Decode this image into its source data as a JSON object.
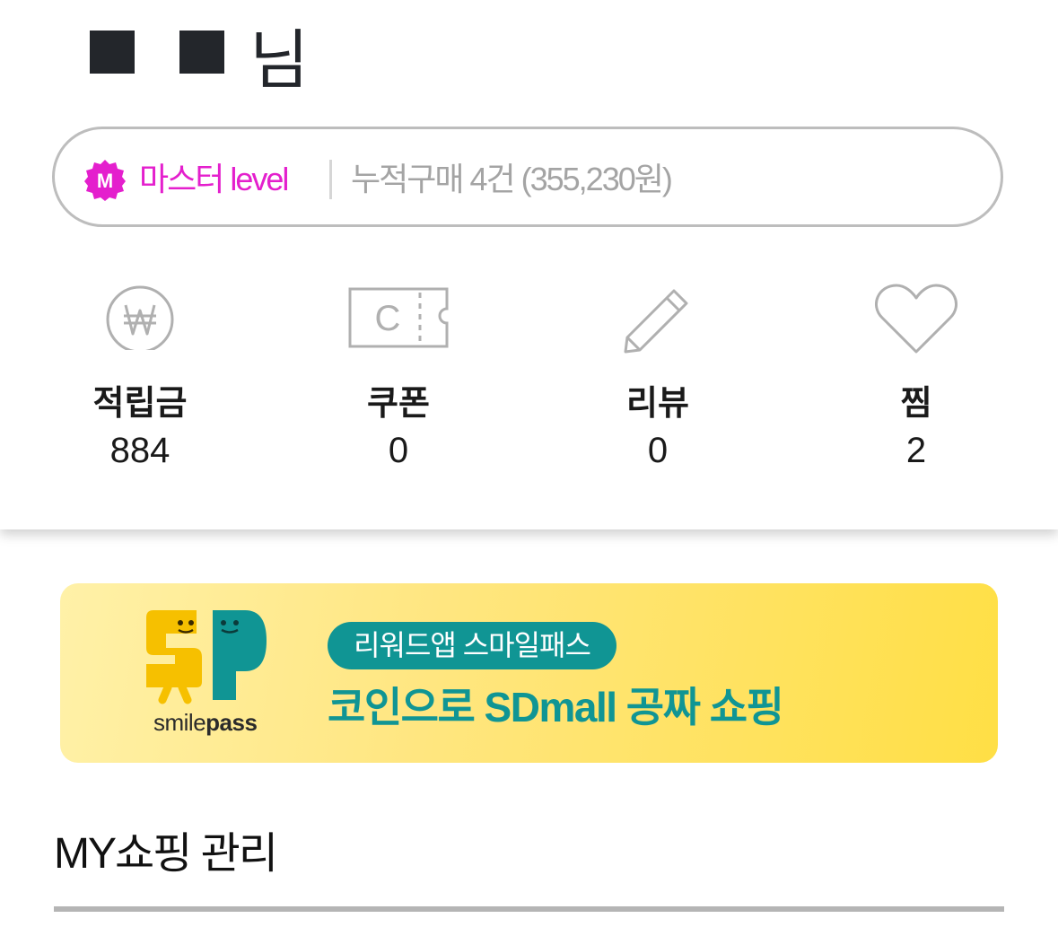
{
  "profile": {
    "name_suffix": "님",
    "level": {
      "badge_letter": "M",
      "name": "마스터 level",
      "summary": "누적구매 4건 (355,230원)",
      "color": "#e41fcd"
    },
    "stats": [
      {
        "icon": "won-coin-icon",
        "label": "적립금",
        "value": "884"
      },
      {
        "icon": "coupon-icon",
        "label": "쿠폰",
        "value": "0"
      },
      {
        "icon": "pencil-icon",
        "label": "리뷰",
        "value": "0"
      },
      {
        "icon": "heart-icon",
        "label": "찜",
        "value": "2"
      }
    ]
  },
  "banner": {
    "wordmark_light": "smile",
    "wordmark_bold": "pass",
    "chip": "리워드앱 스마일패스",
    "headline": "코인으로 SDmall 공짜 쇼핑",
    "accent_color": "#109594"
  },
  "section": {
    "title": "MY쇼핑 관리"
  }
}
